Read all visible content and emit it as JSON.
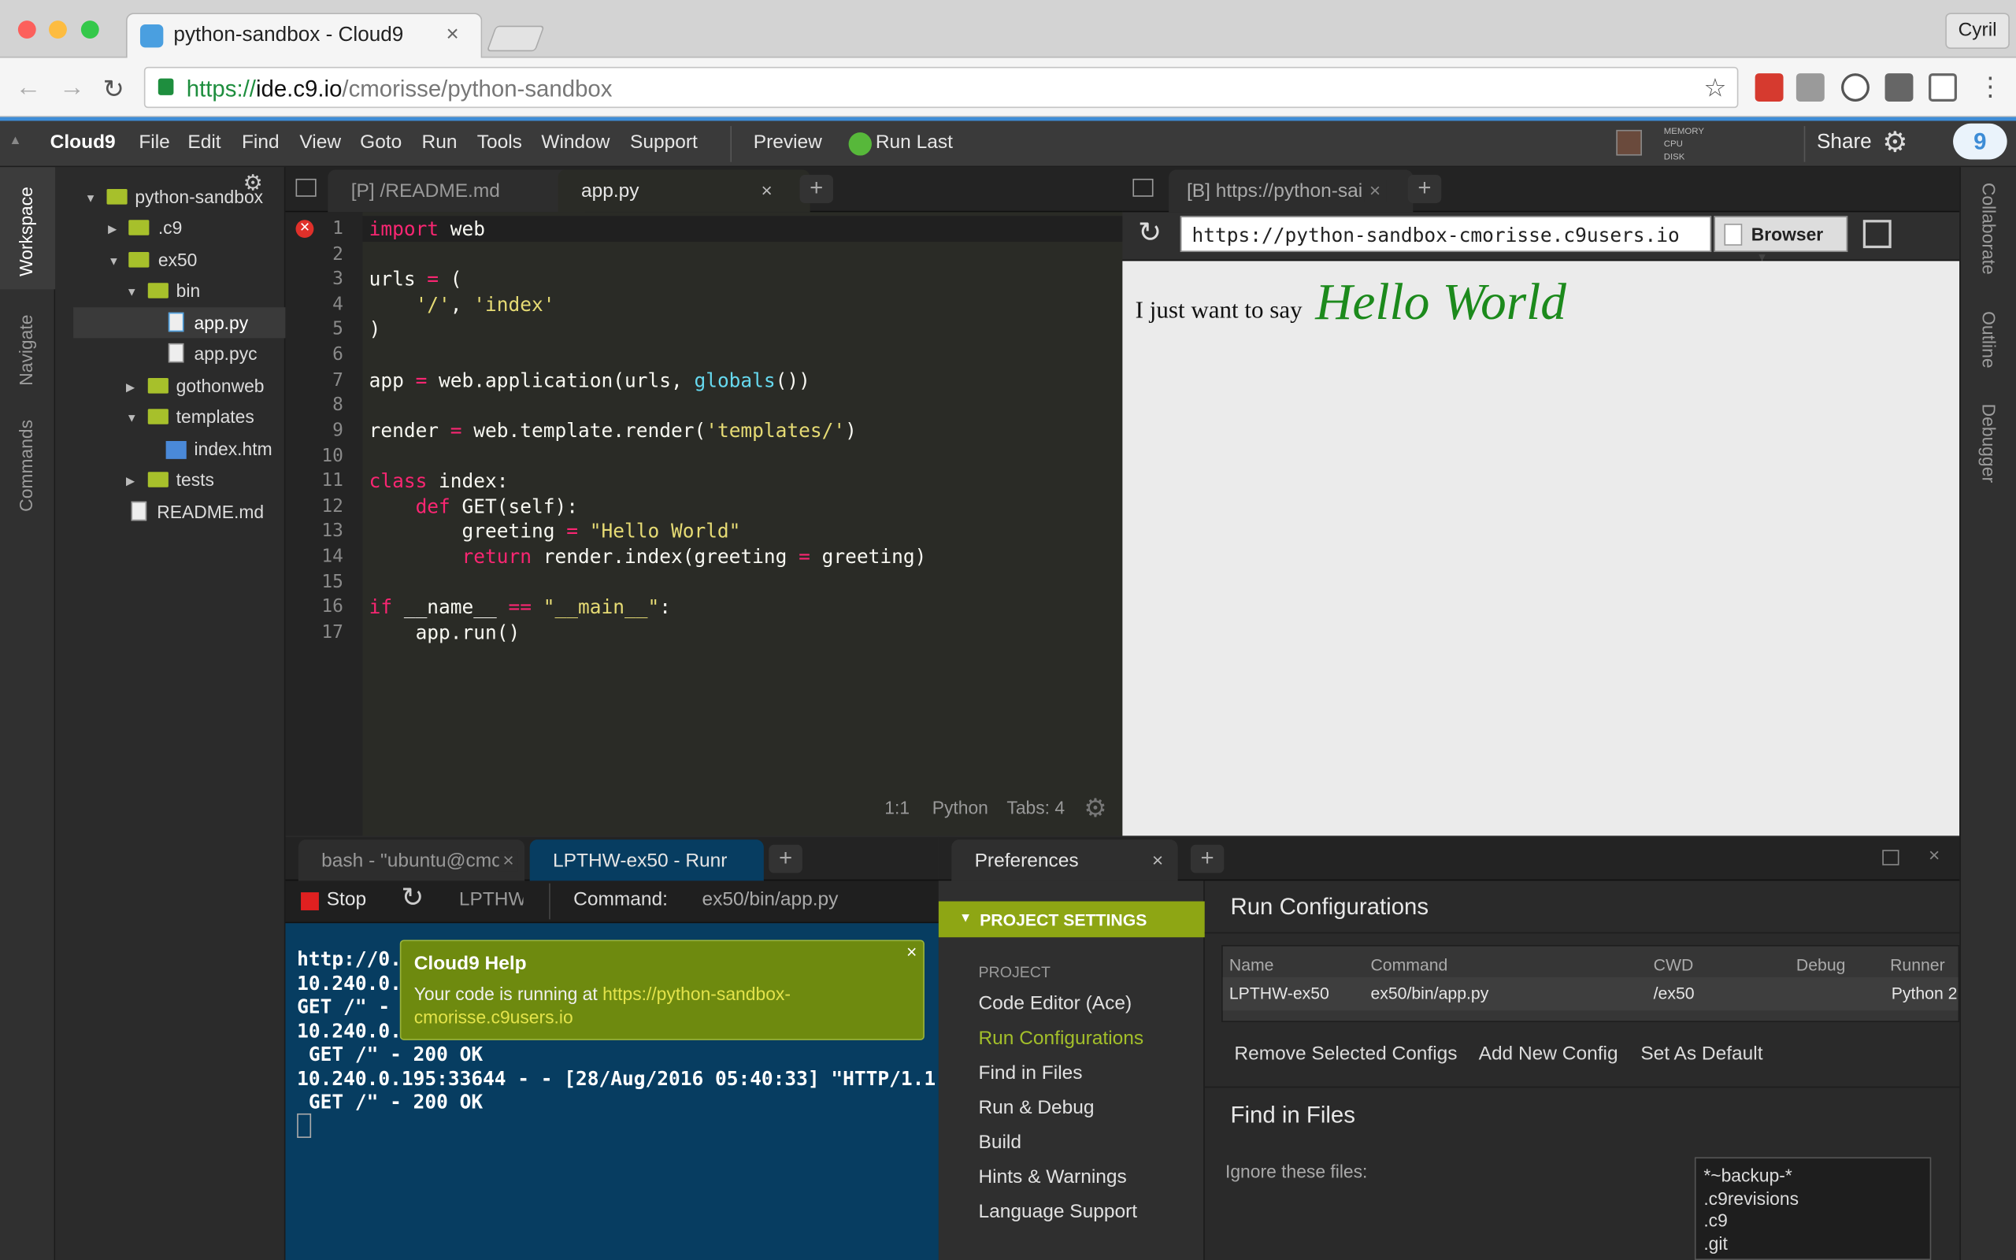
{
  "browser": {
    "tab_title": "python-sandbox - Cloud9",
    "user": "Cyril",
    "url_scheme": "https://",
    "url_host": "ide.c9.io",
    "url_path": "/cmorisse/python-sandbox"
  },
  "menubar": {
    "brand": "Cloud9",
    "items": [
      "File",
      "Edit",
      "Find",
      "View",
      "Goto",
      "Run",
      "Tools",
      "Window",
      "Support"
    ],
    "preview": "Preview",
    "run_last": "Run Last",
    "meters": [
      "MEMORY",
      "CPU",
      "DISK"
    ],
    "share": "Share"
  },
  "left_panels": [
    "Workspace",
    "Navigate",
    "Commands"
  ],
  "right_panels": [
    "Collaborate",
    "Outline",
    "Debugger"
  ],
  "tree": [
    {
      "label": "python-sandbox",
      "type": "folder",
      "open": true
    },
    {
      "label": ".c9",
      "type": "folder",
      "open": false
    },
    {
      "label": "ex50",
      "type": "folder",
      "open": true
    },
    {
      "label": "bin",
      "type": "folder",
      "open": true
    },
    {
      "label": "app.py",
      "type": "file",
      "selected": true
    },
    {
      "label": "app.pyc",
      "type": "file"
    },
    {
      "label": "gothonweb",
      "type": "folder",
      "open": false
    },
    {
      "label": "templates",
      "type": "folder",
      "open": true
    },
    {
      "label": "index.htm",
      "type": "file"
    },
    {
      "label": "tests",
      "type": "folder",
      "open": false
    },
    {
      "label": "README.md",
      "type": "file"
    }
  ],
  "editor": {
    "tabs": [
      "[P] /README.md",
      "app.py"
    ],
    "line_numbers": [
      "1",
      "2",
      "3",
      "4",
      "5",
      "6",
      "7",
      "8",
      "9",
      "10",
      "11",
      "12",
      "13",
      "14",
      "15",
      "16",
      "17"
    ],
    "status": {
      "position": "1:1",
      "language": "Python",
      "tabs": "Tabs: 4"
    }
  },
  "preview": {
    "tab": "[B] https://python-sai",
    "url": "https://python-sandbox-cmorisse.c9users.io",
    "mode": "Browser",
    "text": "I just want to say",
    "heading": "Hello World"
  },
  "terminal": {
    "tabs": [
      "bash - \"ubuntu@cmc",
      "LPTHW-ex50 - Runr"
    ],
    "stop": "Stop",
    "runner": "LPTHW",
    "command_label": "Command:",
    "command": "ex50/bin/app.py",
    "lines": [
      "http://0.",
      "10.240.0.",
      "GET /\" -",
      "10.240.0.",
      " GET /\" - 200 OK",
      "10.240.0.195:33644 - - [28/Aug/2016 05:40:33] \"HTTP/1.1",
      " GET /\" - 200 OK"
    ]
  },
  "help": {
    "title": "Cloud9 Help",
    "text": "Your code is running at",
    "link1": "https://python-sandbox-",
    "link2": "cmorisse.c9users.io"
  },
  "preferences": {
    "tab": "Preferences",
    "section": "PROJECT SETTINGS",
    "group": "PROJECT",
    "items": [
      "Code Editor (Ace)",
      "Run Configurations",
      "Find in Files",
      "Run & Debug",
      "Build",
      "Hints & Warnings",
      "Language Support"
    ],
    "active_item": "Run Configurations",
    "run_title": "Run Configurations",
    "columns": [
      "Name",
      "Command",
      "CWD",
      "Debug",
      "Runner"
    ],
    "row": [
      "LPTHW-ex50",
      "ex50/bin/app.py",
      "/ex50",
      "",
      "Python 2"
    ],
    "actions": [
      "Remove Selected Configs",
      "Add New Config",
      "Set As Default"
    ],
    "find_title": "Find in Files",
    "ignore_label": "Ignore these files:",
    "ignore_values": [
      "*~backup-*",
      ".c9revisions",
      ".c9",
      ".git"
    ]
  },
  "colors": {
    "accent": "#3d8cd6",
    "green": "#8ea614",
    "terminal_bg": "#073d61",
    "hello": "#1c8a1c"
  }
}
